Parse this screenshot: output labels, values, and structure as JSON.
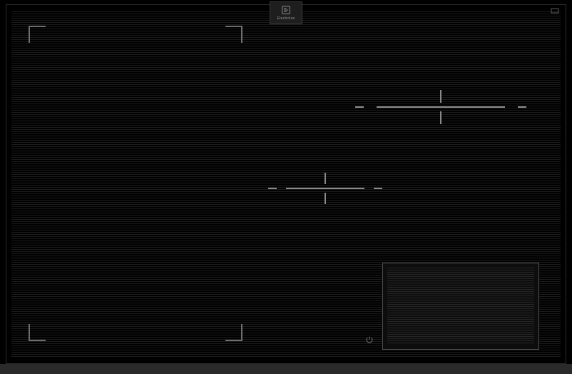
{
  "brand": {
    "name": "Electrolux"
  },
  "zones": {
    "flex": {
      "label": ""
    },
    "rear_right": {
      "label": ""
    },
    "center": {
      "label": ""
    }
  },
  "panel": {
    "power_label": ""
  },
  "colors": {
    "accent": "#8a8a8a",
    "line": "#1c1c1c"
  }
}
